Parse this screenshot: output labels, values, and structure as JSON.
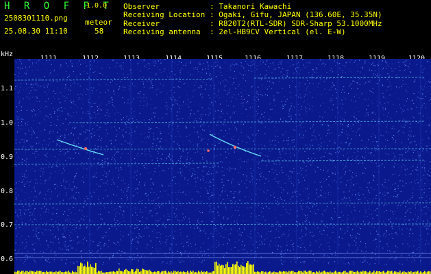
{
  "header": {
    "app_name": "H R O F F T",
    "version": "1.0.0",
    "filename": "2508301110.png",
    "datetime": "25.08.30 11:10",
    "event_type": "meteor",
    "count": "58",
    "info": [
      {
        "label": "Observer",
        "value": ": Takanori Kawachi"
      },
      {
        "label": "Receiving Location",
        "value": ": Ogaki, Gifu, JAPAN (136.60E, 35.35N)"
      },
      {
        "label": "Receiver",
        "value": ": R820T2(RTL-SDR) SDR-Sharp 53.1000MHz"
      },
      {
        "label": "Receiving antenna",
        "value": ": 2el-HB9CV Vertical (el. E-W)"
      }
    ]
  },
  "spectrogram": {
    "unit": "kHz",
    "time_labels": [
      "1111",
      "1112",
      "1113",
      "1114",
      "1115",
      "1116",
      "1117",
      "1118",
      "1119",
      "1120"
    ],
    "freq_labels": [
      "1.1",
      "1.0",
      "0.9",
      "0.8",
      "0.7",
      "0.6"
    ],
    "colors": {
      "background": "#0a1a8c",
      "noise": "#4a6ae0",
      "trace": "#6ff0ff",
      "echo": "#ff6a6a",
      "activity": "#ffff00"
    }
  }
}
